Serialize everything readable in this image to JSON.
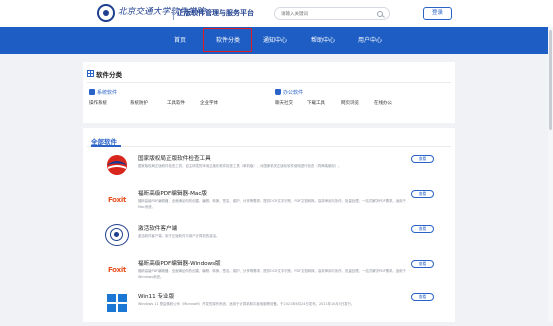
{
  "header": {
    "logo_text": "北京交通大学软件学院",
    "platform_title": "正版软件管理与服务平台",
    "search_placeholder": "请输入关键词",
    "login_label": "登录"
  },
  "nav": {
    "items": [
      {
        "label": "首页"
      },
      {
        "label": "软件分类"
      },
      {
        "label": "通知中心"
      },
      {
        "label": "帮助中心"
      },
      {
        "label": "用户中心"
      }
    ],
    "active_index": 1
  },
  "categories": {
    "title": "软件分类",
    "groups": [
      {
        "name": "系统软件",
        "items": [
          "操作系统",
          "系统防护",
          "工具软件",
          "企业字体"
        ]
      },
      {
        "name": "办公软件",
        "items": [
          "聊天社交",
          "下载工具",
          "网页浏览",
          "在线办公"
        ]
      }
    ]
  },
  "all_software": {
    "title": "全部软件",
    "view_label": "查看",
    "items": [
      {
        "name": "国家版权局正版软件检查工具",
        "desc": "国家版权局正版软件检查工具，自主研发的本地正版化软件检查工具（单机版），对国家机关正版化软件使用进行检查（同两端使用）。",
        "logo": "china-flag-icon"
      },
      {
        "name": "福昕高级PDF编辑器-Mac版",
        "desc": "福昕高级PDF编辑器，全面满足你的创建、编辑、转换、签名、保护、分享等需求，提供OCR文字识别、PDF文档转换、高效审阅与协作、批量处理、一站式解决PDF需求。适用于Mac系统。",
        "logo": "foxit-logo-icon"
      },
      {
        "name": "激活软件客户端",
        "desc": "激活软件客户端，用于正版软件与用户计算机的激活。",
        "logo": "seal-logo-icon"
      },
      {
        "name": "福昕高级PDF编辑器-Windows版",
        "desc": "福昕高级PDF编辑器，全面满足你的创建、编辑、转换、签名、保护、分享等需求，提供OCR文字识别、PDF文档转换、高效审阅与协作、批量处理、一站式解决PDF需求。适用于Windows系统。",
        "logo": "foxit-logo-icon"
      },
      {
        "name": "Win11 专业版",
        "desc": "Windows 11 是由微软公司（Microsoft）开发的操作系统，适用于计算机和平板电脑等设备。于2021年6月24日发布，2021年10月5日发行。",
        "logo": "windows-logo-icon"
      }
    ]
  },
  "colors": {
    "brand_blue": "#1e5ec4",
    "highlight_red": "#e02020",
    "foxit_orange": "#e8501f",
    "windows_blue": "#1a78d4"
  }
}
